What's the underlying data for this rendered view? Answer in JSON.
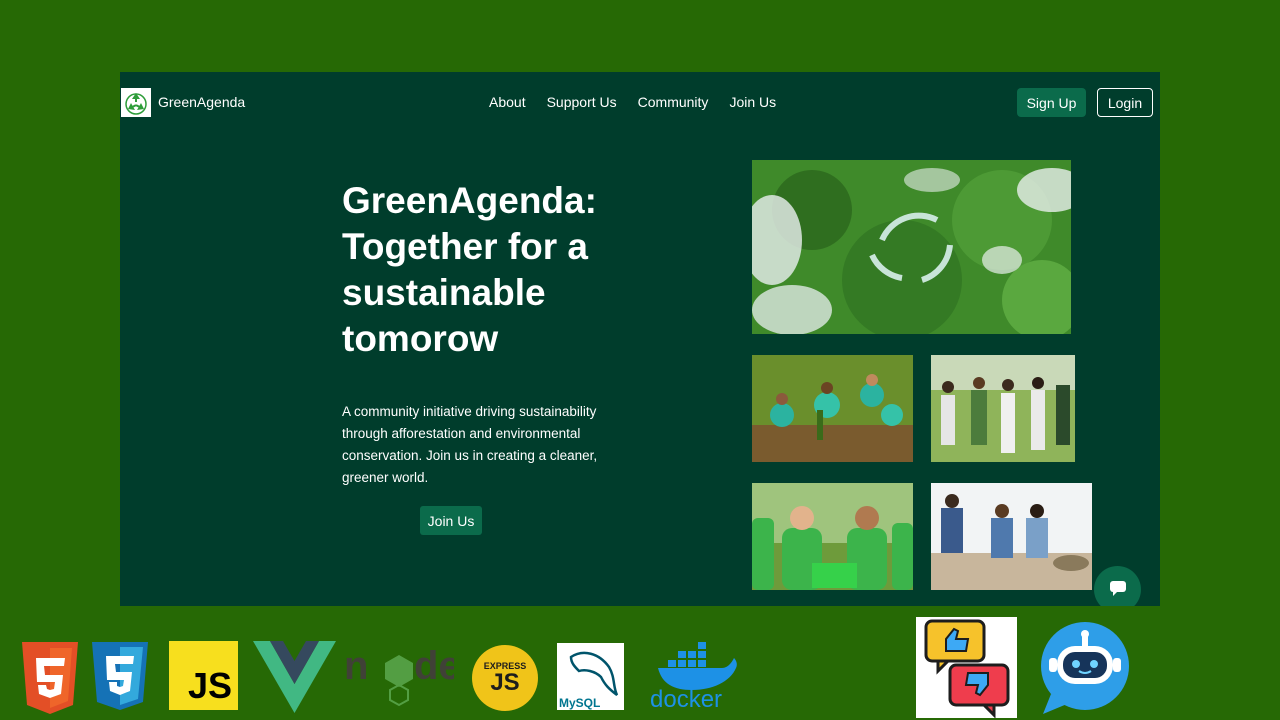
{
  "brand": {
    "name": "GreenAgenda",
    "logo_icon": "recycle-icon"
  },
  "nav": {
    "items": [
      "About",
      "Support Us",
      "Community",
      "Join Us"
    ]
  },
  "auth": {
    "signup_label": "Sign Up",
    "login_label": "Login"
  },
  "hero": {
    "title": "GreenAgenda: Together for a sustainable tomorow",
    "description": "A community initiative driving sustainability through afforestation and environmental conservation. Join us in creating a cleaner, greener world.",
    "cta_label": "Join Us"
  },
  "gallery": {
    "images": [
      "forest-recycle-photo",
      "volunteers-planting-photo",
      "volunteers-garden-photo",
      "volunteers-recycling-photo",
      "volunteers-cleanup-photo"
    ]
  },
  "chat": {
    "icon": "chat-bubble-icon"
  },
  "tech_stack": {
    "express_text": "EXPRESS",
    "express_sub": "JS",
    "js_text": "JS",
    "mysql_text": "MySQL",
    "docker_text": "docker",
    "icons": [
      "html5-icon",
      "css3-icon",
      "javascript-icon",
      "vue-icon",
      "nodejs-icon",
      "express-icon",
      "mysql-icon",
      "docker-icon",
      "feedback-icon",
      "chatbot-icon"
    ]
  },
  "colors": {
    "page_bg": "#266905",
    "frame_bg": "#003d2c",
    "accent": "#0b6b4b"
  }
}
